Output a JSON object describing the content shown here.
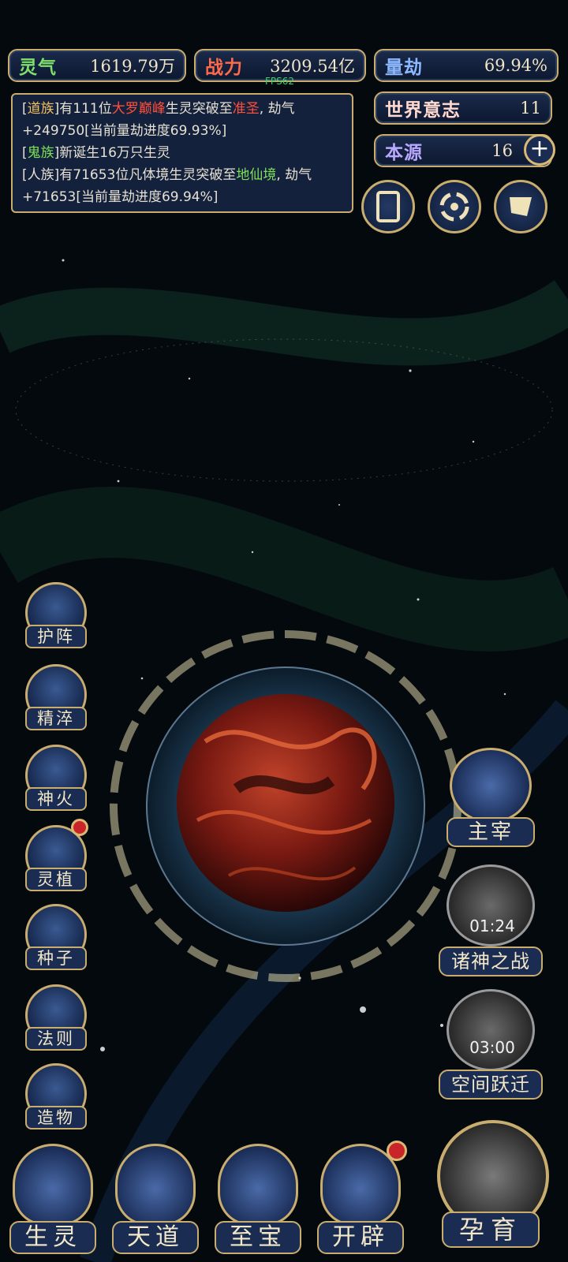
{
  "stats": {
    "lingqi": {
      "label": "灵气",
      "value": "1619.79万"
    },
    "zhanli": {
      "label": "战力",
      "value": "3209.54亿"
    },
    "liangjie": {
      "label": "量劫",
      "value": "69.94%"
    },
    "shijie": {
      "label": "世界意志",
      "value": "11"
    },
    "benyuan": {
      "label": "本源",
      "value": "16"
    }
  },
  "fps": "FPS62",
  "log": [
    {
      "pre": "[",
      "race": "道族",
      "mid": "]有111位",
      "realm": "大罗巅峰",
      "mid2": "生灵突破至",
      "target": "准圣",
      "post": ", 劫气+249750[当前量劫进度69.93%]"
    },
    {
      "pre": "[",
      "race": "鬼族",
      "mid": "]新诞生16万只生灵"
    },
    {
      "pre": "[人族]有71653位凡体境生灵突破至",
      "target": "地仙境",
      "post": ", 劫气+71653[当前量劫进度69.94%]"
    }
  ],
  "side_buttons": [
    "护阵",
    "精淬",
    "神火",
    "灵植",
    "种子",
    "法则",
    "造物"
  ],
  "bottom_buttons": [
    "生灵",
    "天道",
    "至宝",
    "开辟"
  ],
  "right_buttons": {
    "zhuzai": "主宰",
    "zhushen": {
      "label": "诸神之战",
      "timer": "01:24"
    },
    "kongjian": {
      "label": "空间跃迁",
      "timer": "03:00"
    },
    "yunyu": "孕育"
  },
  "colors": {
    "gold": "#c9ad6e",
    "panel": "#1a2c52",
    "alert": "#c8242a"
  }
}
